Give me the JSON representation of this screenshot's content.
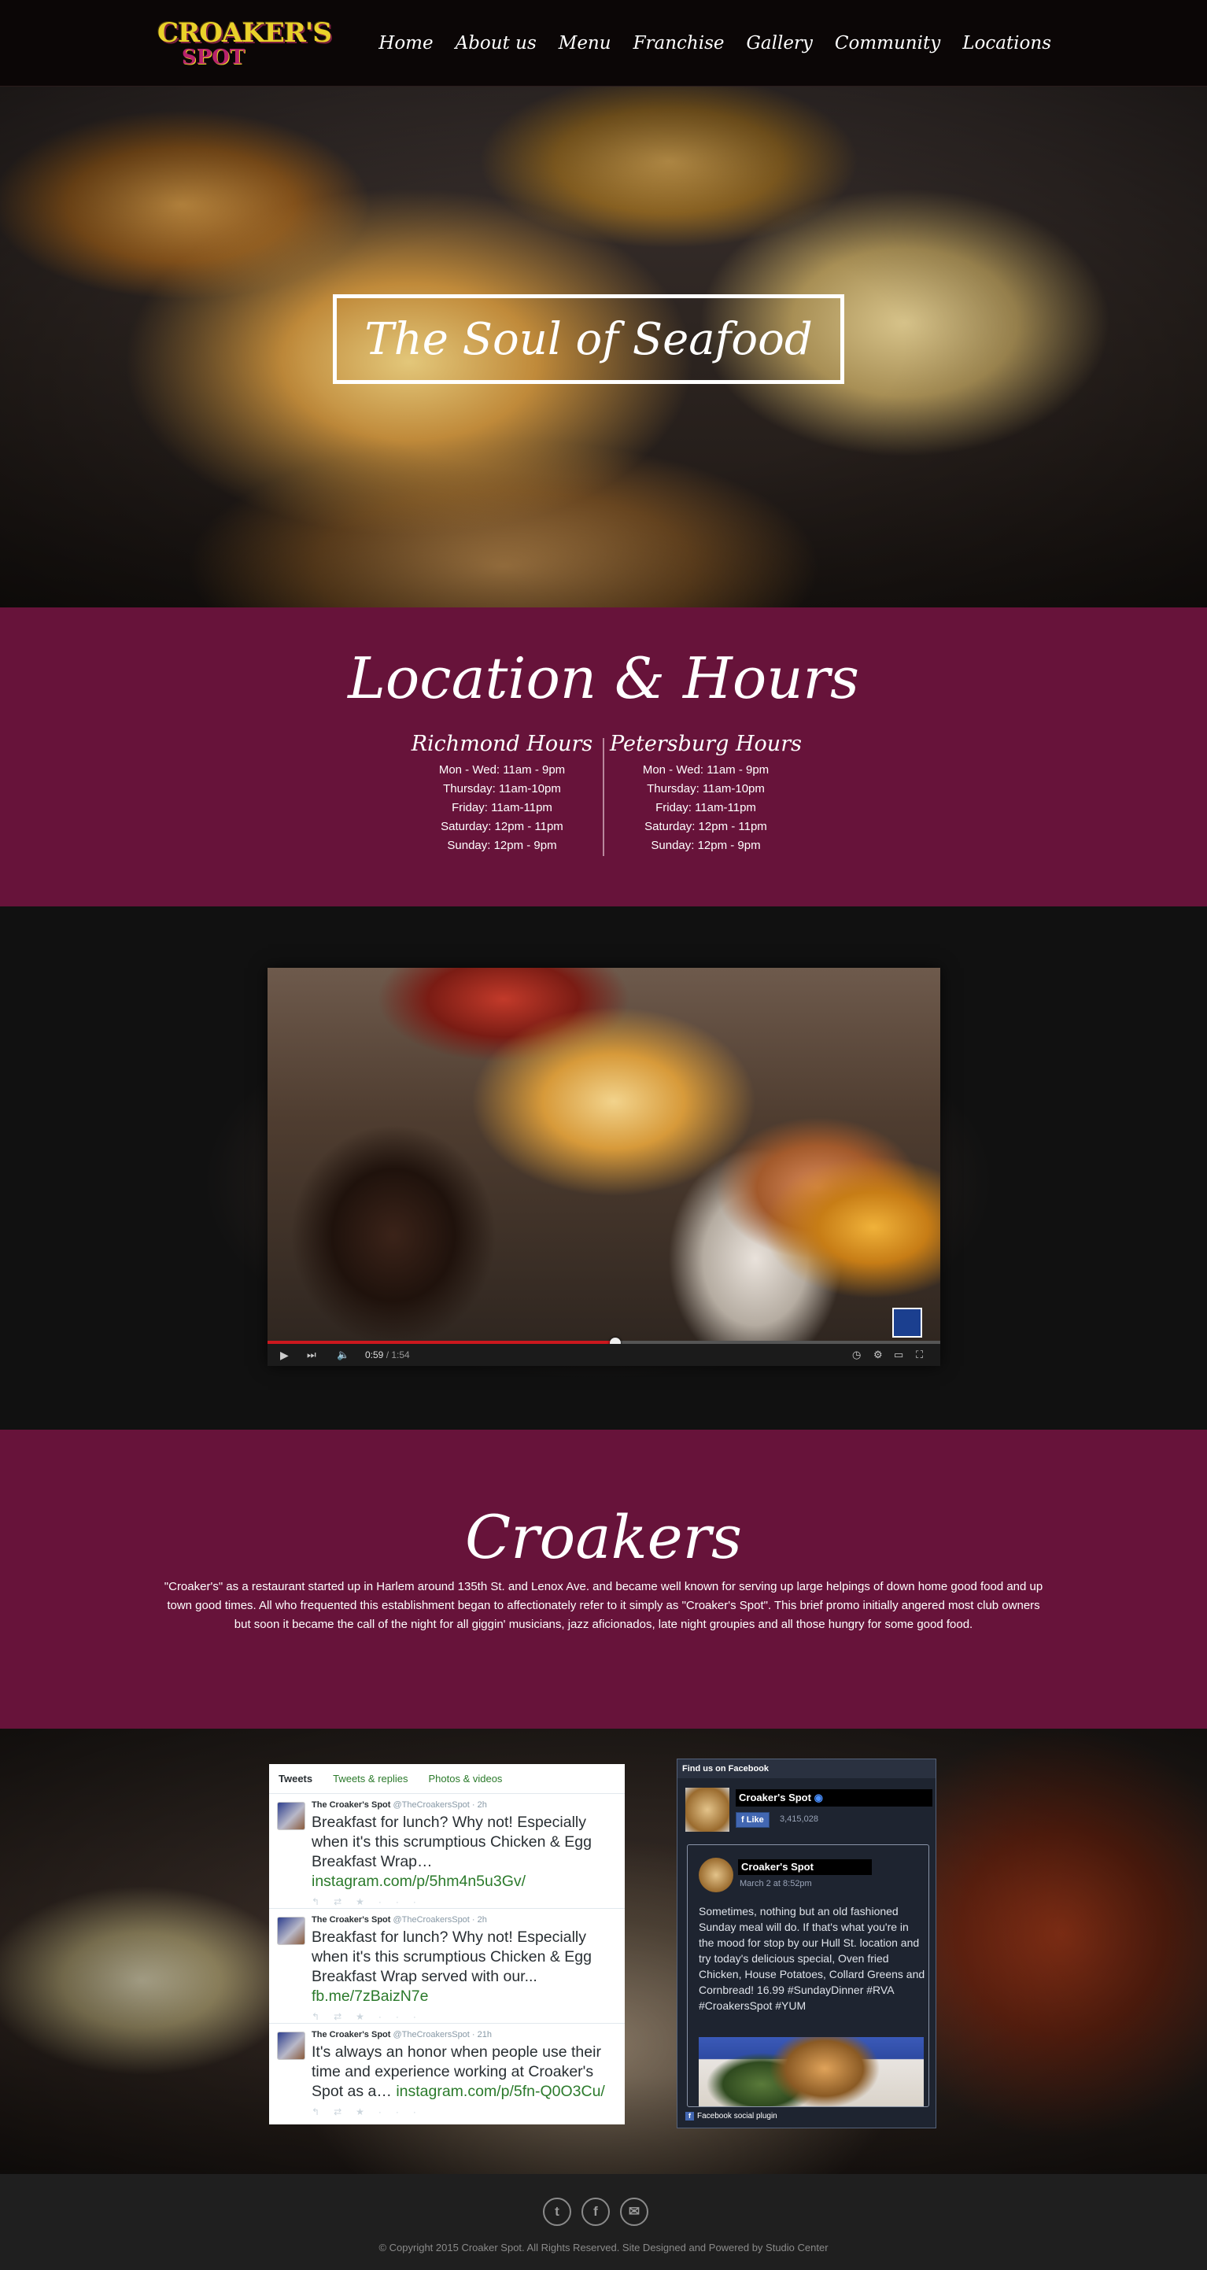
{
  "nav": {
    "logo_line1": "CROAKER'S",
    "logo_line2": "SPOT",
    "items": [
      "Home",
      "About us",
      "Menu",
      "Franchise",
      "Gallery",
      "Community",
      "Locations"
    ]
  },
  "hero": {
    "title": "The Soul of Seafood"
  },
  "location": {
    "heading": "Location & Hours",
    "richmond": {
      "title": "Richmond Hours",
      "lines": [
        "Mon - Wed: 11am - 9pm",
        "Thursday: 11am-10pm",
        "Friday: 11am-11pm",
        "Saturday: 12pm - 11pm",
        "Sunday: 12pm - 9pm"
      ]
    },
    "petersburg": {
      "title": "Petersburg Hours",
      "lines": [
        "Mon - Wed: 11am - 9pm",
        "Thursday: 11am-10pm",
        "Friday: 11am-11pm",
        "Saturday: 12pm - 11pm",
        "Sunday: 12pm - 9pm"
      ]
    }
  },
  "video": {
    "time_current": "0:59",
    "time_total": "1:54",
    "progress": 0.517
  },
  "about": {
    "heading": "Croakers",
    "body": "\"Croaker's\" as a restaurant started up in Harlem around 135th St. and Lenox Ave. and became well known for serving up large helpings of down home good food and up town good times. All who frequented this establishment began to affectionately refer to it simply as \"Croaker's Spot\". This brief promo initially angered most club owners but soon it became the call of the night for all giggin' musicians, jazz aficionados, late night groupies and all those hungry for some good food."
  },
  "twitter": {
    "tabs": [
      "Tweets",
      "Tweets & replies",
      "Photos & videos"
    ],
    "tweets": [
      {
        "name": "The Croaker's Spot",
        "handle": "@TheCroakersSpot",
        "age": "2h",
        "text": "Breakfast for lunch? Why not! Especially when it's this scrumptious Chicken & Egg Breakfast Wrap…",
        "link": "instagram.com/p/5hm4n5u3Gv/"
      },
      {
        "name": "The Croaker's Spot",
        "handle": "@TheCroakersSpot",
        "age": "2h",
        "text": "Breakfast for lunch? Why not! Especially when it's this scrumptious Chicken & Egg Breakfast Wrap served with our...",
        "link": "fb.me/7zBaizN7e"
      },
      {
        "name": "The Croaker's Spot",
        "handle": "@TheCroakersSpot",
        "age": "21h",
        "text": "It's always an honor when people use their time and experience working at Croaker's Spot as a…",
        "link": "instagram.com/p/5fn-Q0O3Cu/"
      }
    ]
  },
  "facebook": {
    "header": "Find us on Facebook",
    "page_name": "Croaker's Spot",
    "like_label": "Like",
    "like_count": "3,415,028",
    "post_name": "Croaker's Spot",
    "post_date": "March 2 at 8:52pm",
    "post_text": "Sometimes, nothing but an old fashioned Sunday meal will do. If that's what you're in the mood for stop by our Hull St. location and try today's delicious special, Oven fried Chicken, House Potatoes, Collard Greens and Cornbread! 16.99 #SundayDinner #RVA #CroakersSpot #YUM",
    "footer": "Facebook social plugin"
  },
  "footer": {
    "copyright": "© Copyright 2015 Croaker Spot. All Rights Reserved. Site Designed and Powered by Studio Center"
  }
}
